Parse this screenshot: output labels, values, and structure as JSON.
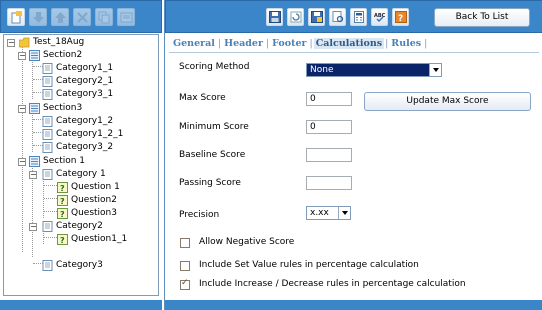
{
  "left_toolbar": {
    "buttons": [
      {
        "icon": "new-document-icon"
      },
      {
        "icon": "move-down-icon"
      },
      {
        "icon": "move-up-icon"
      },
      {
        "icon": "delete-icon"
      },
      {
        "icon": "copy-icon"
      },
      {
        "icon": "preview-icon"
      }
    ]
  },
  "tree": {
    "root": "Test_18Aug",
    "section2": {
      "label": "Section2",
      "items": [
        "Category1_1",
        "Category2_1",
        "Category3_1"
      ]
    },
    "section3": {
      "label": "Section3",
      "items": [
        "Category1_2",
        "Category1_2_1",
        "Category3_2"
      ]
    },
    "section1": {
      "label": "Section 1",
      "category1": {
        "label": "Category 1",
        "questions": [
          "Question 1",
          "Question2",
          "Question3"
        ]
      },
      "category2": {
        "label": "Category2",
        "questions": [
          "Question1_1"
        ]
      },
      "category3": {
        "label": "Category3"
      }
    }
  },
  "right_toolbar": {
    "buttons": [
      {
        "icon": "save-icon"
      },
      {
        "icon": "refresh-icon"
      },
      {
        "icon": "save-as-icon"
      },
      {
        "icon": "print-preview-icon"
      },
      {
        "icon": "calculator-icon"
      },
      {
        "icon": "spell-check-icon"
      },
      {
        "icon": "help-icon"
      }
    ],
    "spell_label": "ABC",
    "help_label": "?",
    "back_label": "Back To List"
  },
  "tabs": [
    {
      "label": "General",
      "active": false
    },
    {
      "label": "Header",
      "active": false
    },
    {
      "label": "Footer",
      "active": false
    },
    {
      "label": "Calculations",
      "active": true
    },
    {
      "label": "Rules",
      "active": false
    }
  ],
  "tab_separator": "|",
  "form": {
    "scoring_method": {
      "label": "Scoring Method",
      "value": "None"
    },
    "max_score": {
      "label": "Max Score",
      "value": "0"
    },
    "update_button": "Update Max Score",
    "minimum_score": {
      "label": "Minimum Score",
      "value": "0"
    },
    "baseline_score": {
      "label": "Baseline Score",
      "value": ""
    },
    "passing_score": {
      "label": "Passing Score",
      "value": ""
    },
    "precision": {
      "label": "Precision",
      "value": "x.xx"
    },
    "checkboxes": [
      {
        "label": "Allow Negative Score",
        "checked": false
      },
      {
        "label": "Include Set Value rules in percentage calculation",
        "checked": false
      },
      {
        "label": "Include Increase / Decrease rules in percentage calculation",
        "checked": true
      }
    ]
  },
  "colors": {
    "toolbar_blue": "#3b86c9",
    "tab_blue": "#4a80b4",
    "select_highlight": "#0a246a"
  }
}
